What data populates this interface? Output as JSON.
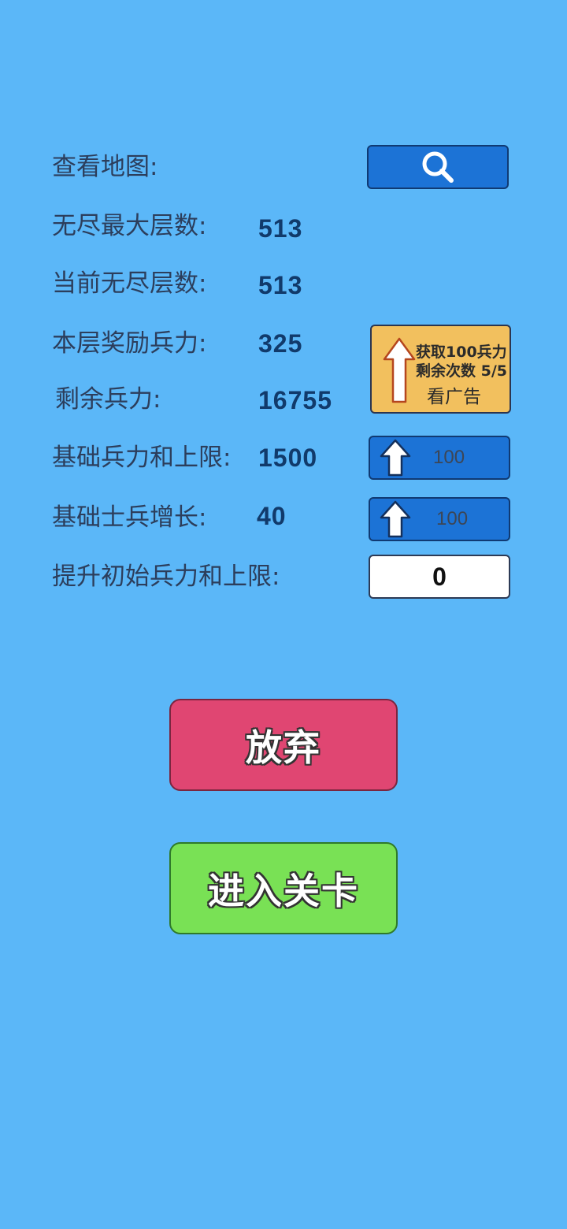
{
  "rows": {
    "view_map": {
      "label": "查看地图:"
    },
    "max_layer": {
      "label": "无尽最大层数:",
      "value": "513"
    },
    "current_layer": {
      "label": "当前无尽层数:",
      "value": "513"
    },
    "reward_troops": {
      "label": "本层奖励兵力:",
      "value": "325"
    },
    "remaining_troops": {
      "label": "剩余兵力:",
      "value": "16755"
    },
    "base_troops_cap": {
      "label": "基础兵力和上限:",
      "value": "1500",
      "upgrade_cost": "100"
    },
    "base_soldier_growth": {
      "label": "基础士兵增长:",
      "value": "40",
      "upgrade_cost": "100"
    },
    "raise_initial": {
      "label": "提升初始兵力和上限:",
      "input_value": "0"
    }
  },
  "ad_button": {
    "line1": "获取100兵力",
    "line2": "剩余次数 5/5",
    "line3": "看广告"
  },
  "buttons": {
    "abandon": "放弃",
    "enter_level": "进入关卡"
  },
  "colors": {
    "background": "#5bb7f8",
    "button_blue": "#1c73d6",
    "ad_orange": "#f2c05e",
    "abandon_red": "#e04672",
    "enter_green": "#79e155"
  },
  "icons": {
    "search": "search-icon",
    "upgrade": "up-arrow-icon"
  }
}
